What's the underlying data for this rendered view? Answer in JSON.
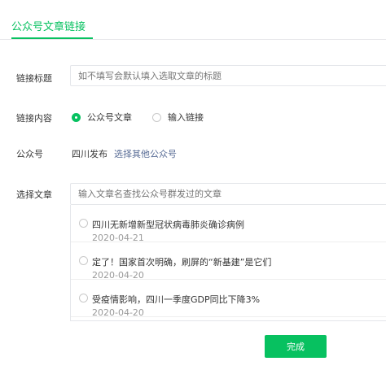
{
  "tabs": {
    "active_label": "公众号文章链接"
  },
  "form": {
    "title_label": "链接标题",
    "title_placeholder": "如不填写会默认填入选取文章的标题",
    "content_label": "链接内容",
    "content_options": [
      {
        "label": "公众号文章",
        "checked": true
      },
      {
        "label": "输入链接",
        "checked": false
      }
    ],
    "account_label": "公众号",
    "account_name": "四川发布",
    "account_change_link": "选择其他公众号",
    "article_label": "选择文章",
    "article_search_placeholder": "输入文章名查找公众号群发过的文章"
  },
  "articles": [
    {
      "title": "四川无新增新型冠状病毒肺炎确诊病例",
      "date": "2020-04-21"
    },
    {
      "title": "定了！国家首次明确，刷屏的“新基建”是它们",
      "date": "2020-04-20"
    },
    {
      "title": "受疫情影响，四川一季度GDP同比下降3%",
      "date": "2020-04-20"
    }
  ],
  "footer": {
    "done_label": "完成"
  },
  "colors": {
    "accent": "#07c160",
    "link": "#576b95"
  }
}
